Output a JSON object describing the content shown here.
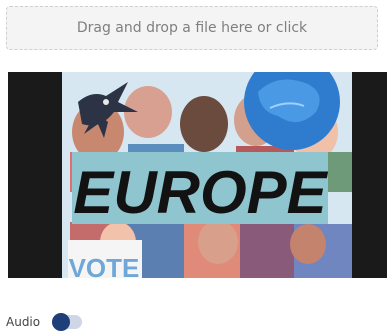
{
  "dropzone": {
    "label": "Drag and drop a file here or click"
  },
  "preview": {
    "title_text": "EUROPE",
    "sign_text": "VOTE",
    "colors": {
      "frame": "#1a1a1a",
      "title_bg": "#8fc5cf",
      "title_fg": "#121212",
      "globe": "#2f7ccf",
      "sky": "#d7e7f2"
    }
  },
  "audio": {
    "label": "Audio",
    "enabled": true
  }
}
